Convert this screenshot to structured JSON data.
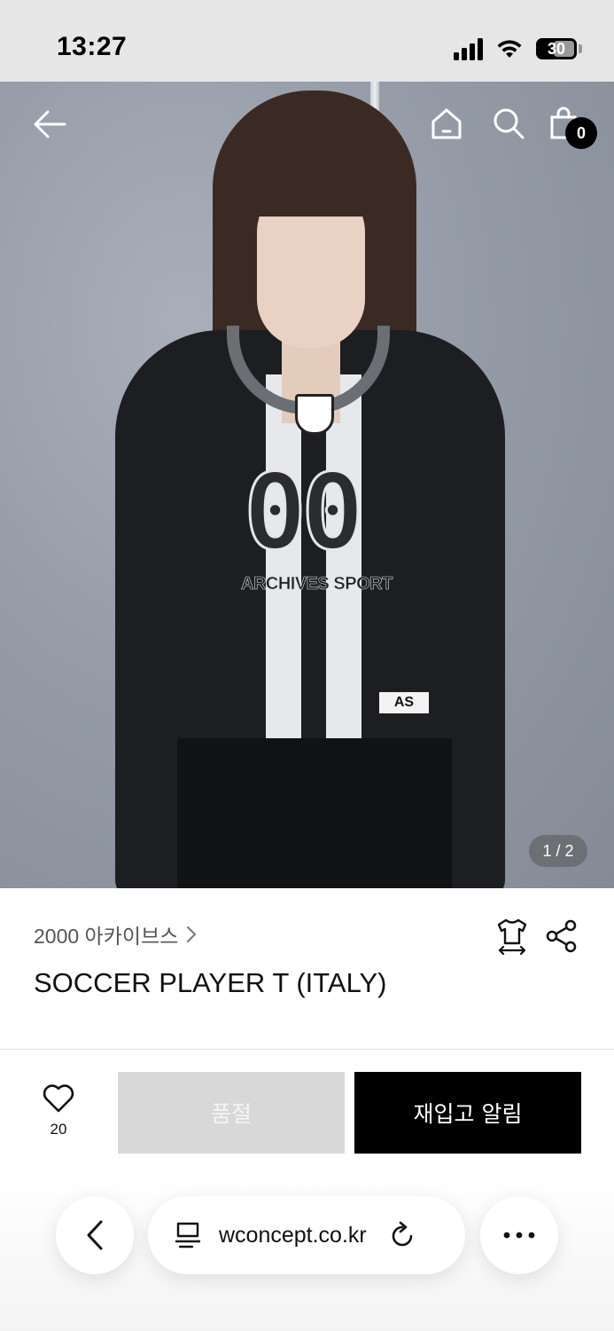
{
  "status_bar": {
    "time": "13:27",
    "battery": "30"
  },
  "hero": {
    "jersey_number": "00",
    "jersey_text": "ARCHIVES SPORT",
    "hem_logo": "AS",
    "slide_counter": "1 / 2"
  },
  "nav": {
    "cart_count": "0"
  },
  "product": {
    "brand": "2000 아카이브스",
    "title": "SOCCER PLAYER T (ITALY)"
  },
  "actions": {
    "like_count": "20",
    "soldout_label": "품절",
    "restock_label": "재입고 알림"
  },
  "browser": {
    "url": "wconcept.co.kr"
  }
}
